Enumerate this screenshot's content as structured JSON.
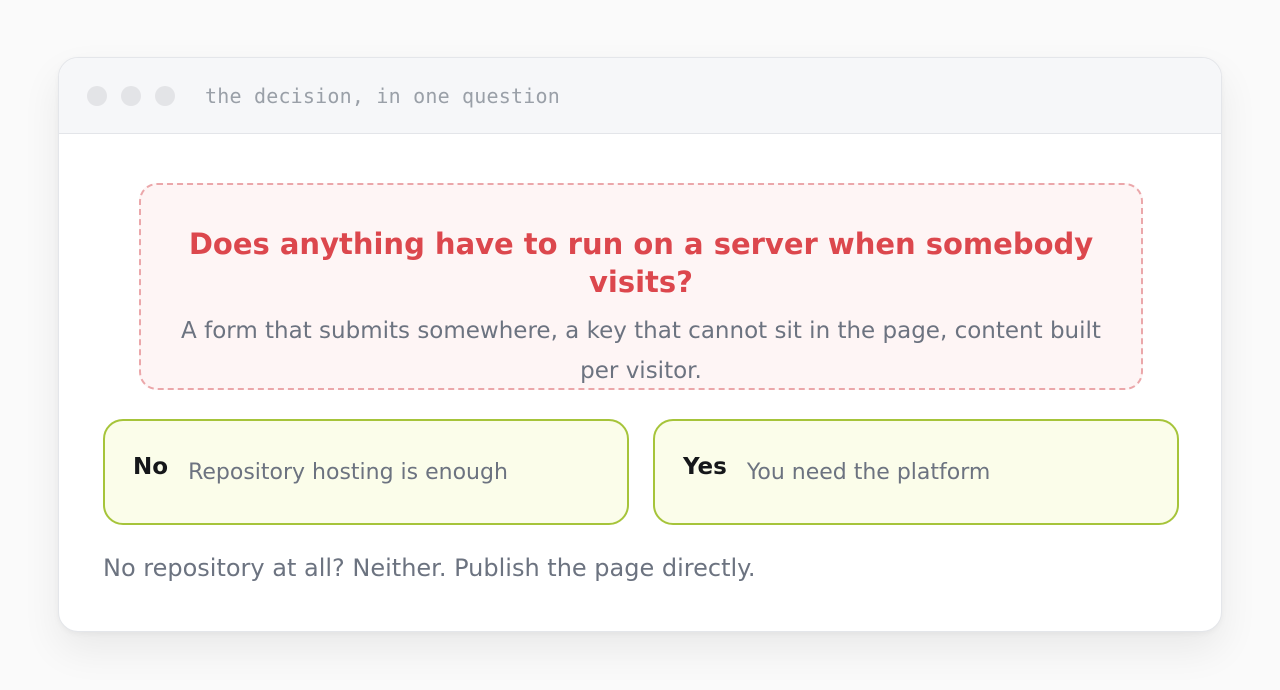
{
  "window": {
    "title": "the decision, in one question"
  },
  "question": {
    "title": "Does anything have to run on a server when somebody visits?",
    "subtitle": "A form that submits somewhere, a key that cannot sit in the page, content built per visitor."
  },
  "answers": [
    {
      "key": "No",
      "text": "Repository hosting is enough"
    },
    {
      "key": "Yes",
      "text": "You need the platform"
    }
  ],
  "footnote": "No repository at all? Neither. Publish the page directly.",
  "colors": {
    "question_accent": "#dc474d",
    "question_border": "#eba7aa",
    "answer_border": "#a6c43a",
    "answer_background": "#fbfdea"
  }
}
